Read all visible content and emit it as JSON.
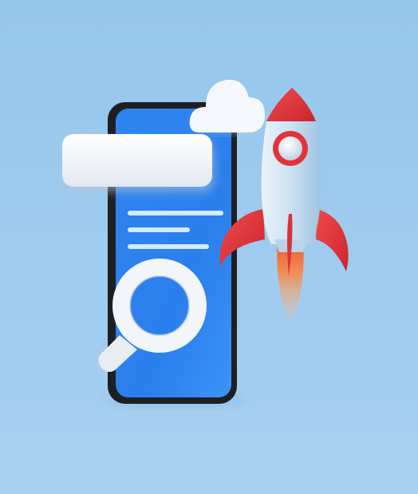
{
  "scene": {
    "kind": "3d-illustration",
    "subjects": [
      "smartphone",
      "search-bar",
      "magnifying-glass",
      "cloud",
      "rocket"
    ],
    "colors": {
      "background_top": "#97c7ed",
      "background_bottom": "#a9d1f2",
      "phone_body": "#1f1f24",
      "phone_screen": "#2f86f0",
      "screen_lines": "#cfe6ff",
      "search_bar": "#f3f5f8",
      "magnifier": "#f2f5f9",
      "cloud": "#f4f7fb",
      "rocket_body": "#c9e0f2",
      "rocket_red": "#e0363c",
      "rocket_window_glass": "#e7f0f7",
      "flame_outer": "#f2b184",
      "flame_inner": "#ec6a3b"
    }
  }
}
